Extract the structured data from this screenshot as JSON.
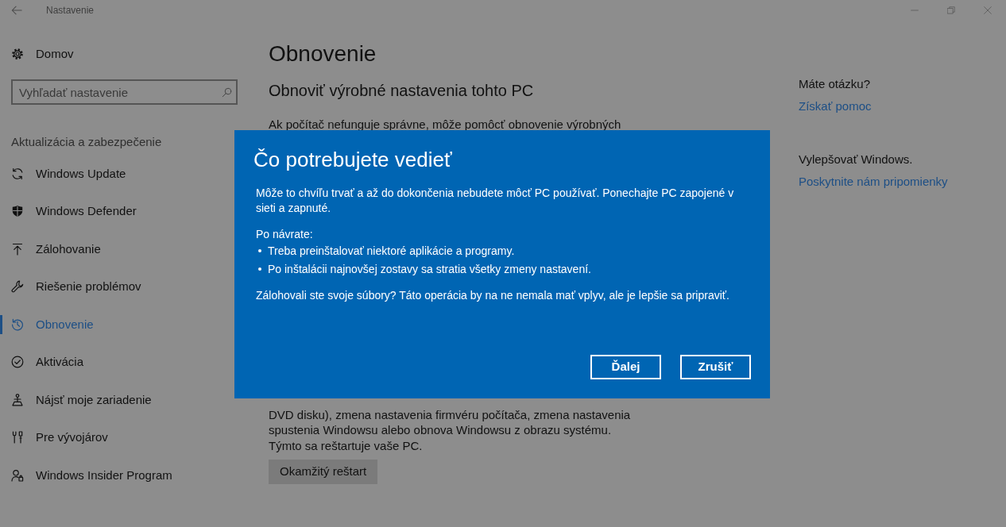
{
  "window": {
    "title": "Nastavenie"
  },
  "sidebar": {
    "home": "Domov",
    "search": {
      "placeholder": "Vyhľadať nastavenie"
    },
    "section": "Aktualizácia a zabezpečenie",
    "items": [
      {
        "label": "Windows Update",
        "selected": false
      },
      {
        "label": "Windows Defender",
        "selected": false
      },
      {
        "label": "Zálohovanie",
        "selected": false
      },
      {
        "label": "Riešenie problémov",
        "selected": false
      },
      {
        "label": "Obnovenie",
        "selected": true
      },
      {
        "label": "Aktivácia",
        "selected": false
      },
      {
        "label": "Nájsť moje zariadenie",
        "selected": false
      },
      {
        "label": "Pre vývojárov",
        "selected": false
      },
      {
        "label": "Windows Insider Program",
        "selected": false
      }
    ]
  },
  "main": {
    "title": "Obnovenie",
    "section_title": "Obnoviť výrobné nastavenia tohto PC",
    "paragraph_1": "Ak počítač nefunguje správne, môže pomôcť obnovenie výrobných",
    "paragraph_2": "DVD disku), zmena nastavenia firmvéru počítača, zmena nastavenia spustenia Windowsu alebo obnova Windowsu z obrazu systému. Týmto sa reštartuje vaše PC.",
    "restart_button": "Okamžitý reštart"
  },
  "help": {
    "question": "Máte otázku?",
    "help_link": "Získať pomoc",
    "improve": "Vylepšovať Windows.",
    "feedback_link": "Poskytnite nám pripomienky"
  },
  "dialog": {
    "title": "Čo potrebujete vedieť",
    "intro": "Môže to chvíľu trvať a až do dokončenia nebudete môcť PC používať. Ponechajte PC zapojené v sieti a zapnuté.",
    "list_heading": "Po návrate:",
    "bullets": [
      "Treba preinštalovať niektoré aplikácie a programy.",
      "Po inštalácii najnovšej zostavy sa stratia všetky zmeny nastavení."
    ],
    "note": "Zálohovali ste svoje súbory? Táto operácia by na ne nemala mať vplyv, ale je lepšie sa pripraviť.",
    "buttons": [
      "Ďalej",
      "Zrušiť"
    ]
  }
}
